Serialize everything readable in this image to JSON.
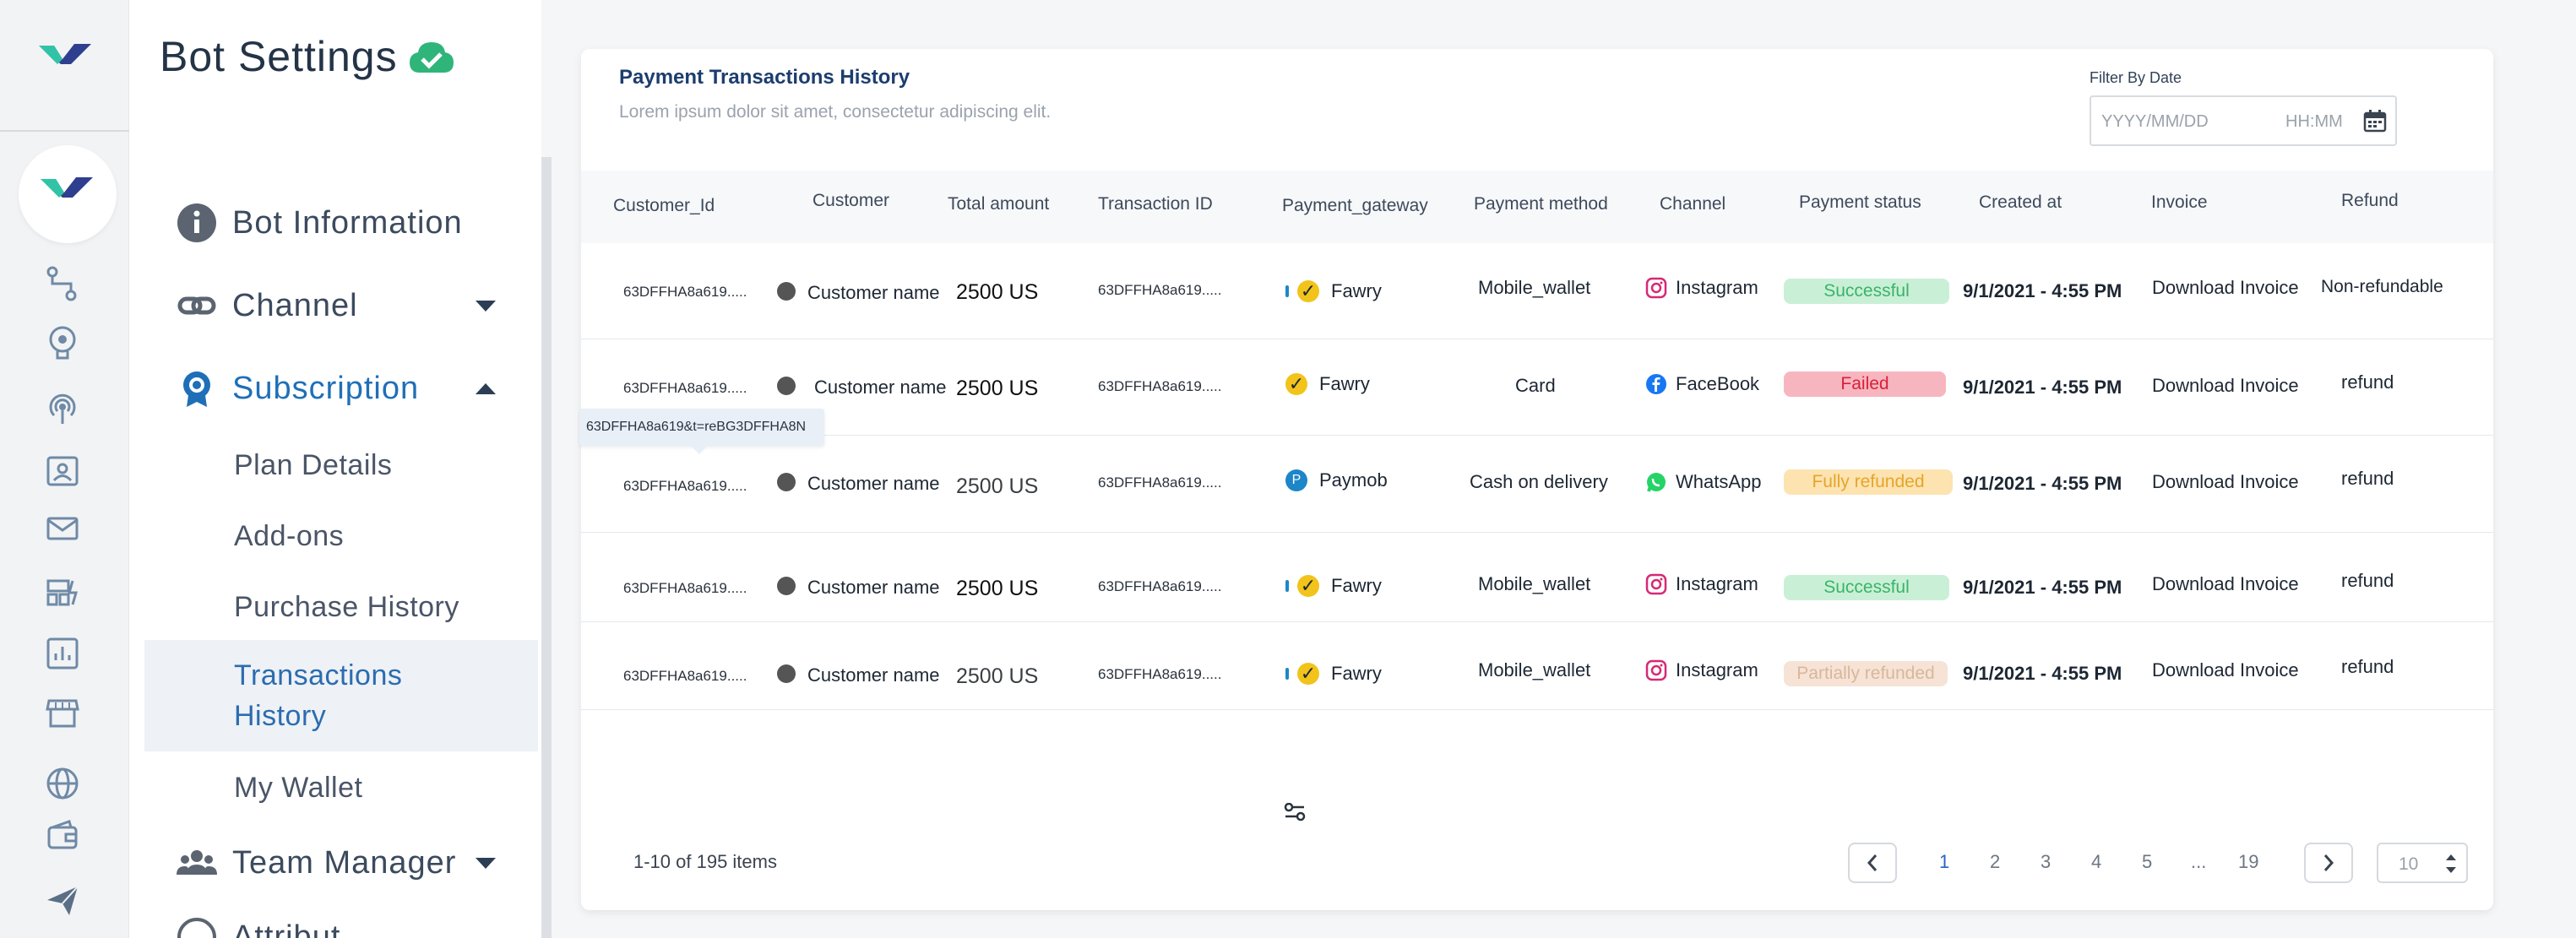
{
  "app": {
    "title": "Bot Settings"
  },
  "nav": {
    "bot_information": "Bot Information",
    "channel": "Channel",
    "subscription": "Subscription",
    "sub_items": [
      "Plan Details",
      "Add-ons",
      "Purchase History",
      "Transactions\nHistory",
      "My Wallet"
    ],
    "team_manager": "Team Manager",
    "partial_next": "Attribut"
  },
  "rail_icons": [
    "flow-icon",
    "brain-icon",
    "broadcast-icon",
    "contact-card-icon",
    "mail-icon",
    "dashboard-icon",
    "analytics-icon",
    "store-icon",
    "globe-icon",
    "wallet-icon",
    "send-icon"
  ],
  "card": {
    "title": "Payment Transactions History",
    "subtitle": "Lorem ipsum dolor sit amet, consectetur adipiscing elit.",
    "filter_label": "Filter By Date",
    "date_placeholder": "YYYY/MM/DD",
    "time_placeholder": "HH:MM"
  },
  "columns": [
    "Customer_Id",
    "Customer",
    "Total amount",
    "Transaction ID",
    "Payment_gateway",
    "Payment method",
    "Channel",
    "Payment status",
    "Created at",
    "Invoice",
    "Refund"
  ],
  "rows": [
    {
      "customer_id": "63DFFHA8a619.....",
      "customer": "Customer name",
      "amount": "2500 US",
      "transaction_id": "63DFFHA8a619.....",
      "gateway": "Fawry",
      "method": "Mobile_wallet",
      "channel": "Instagram",
      "status": "Successful",
      "created": "9/1/2021 - 4:55 PM",
      "invoice": "Download Invoice",
      "refund": "Non-refundable"
    },
    {
      "customer_id": "63DFFHA8a619.....",
      "customer": "Customer name",
      "amount": "2500 US",
      "transaction_id": "63DFFHA8a619.....",
      "gateway": "Fawry",
      "method": "Card",
      "channel": "FaceBook",
      "status": "Failed",
      "created": "9/1/2021 - 4:55 PM",
      "invoice": "Download Invoice",
      "refund": "refund"
    },
    {
      "customer_id": "63DFFHA8a619.....",
      "customer": "Customer name",
      "amount": "2500 US",
      "transaction_id": "63DFFHA8a619.....",
      "gateway": "Paymob",
      "method": "Cash on delivery",
      "channel": "WhatsApp",
      "status": "Fully refunded",
      "created": "9/1/2021 - 4:55 PM",
      "invoice": "Download Invoice",
      "refund": "refund"
    },
    {
      "customer_id": "63DFFHA8a619.....",
      "customer": "Customer name",
      "amount": "2500 US",
      "transaction_id": "63DFFHA8a619.....",
      "gateway": "Fawry",
      "method": "Mobile_wallet",
      "channel": "Instagram",
      "status": "Successful",
      "created": "9/1/2021 - 4:55 PM",
      "invoice": "Download Invoice",
      "refund": "refund"
    },
    {
      "customer_id": "63DFFHA8a619.....",
      "customer": "Customer name",
      "amount": "2500 US",
      "transaction_id": "63DFFHA8a619.....",
      "gateway": "Fawry",
      "method": "Mobile_wallet",
      "channel": "Instagram",
      "status": "Partially refunded",
      "created": "9/1/2021 - 4:55 PM",
      "invoice": "Download Invoice",
      "refund": "refund"
    }
  ],
  "tooltip": "63DFFHA8a619&t=reBG3DFFHA8N",
  "pagination": {
    "info": "1-10 of 195 items",
    "pages": [
      "1",
      "2",
      "3",
      "4",
      "5",
      "...",
      "19"
    ],
    "active_page": "1",
    "page_size": "10"
  },
  "colors": {
    "accent": "#1f6fb8",
    "link": "#2a63c7",
    "success_bg": "#c9f0d6",
    "success_fg": "#3bb36a",
    "failed_bg": "#f7b6bf",
    "failed_fg": "#d8203a",
    "fully_bg": "#fde3b0",
    "fully_fg": "#e6a52a",
    "partial_bg": "#f6e3d6",
    "partial_fg": "#d8b79c"
  }
}
